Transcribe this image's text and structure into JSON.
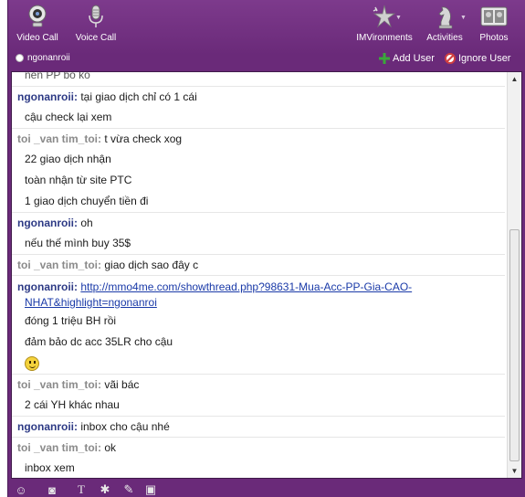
{
  "toolbar": {
    "video_call": "Video Call",
    "voice_call": "Voice Call",
    "imvironments": "IMVironments",
    "activities": "Activities",
    "photos": "Photos"
  },
  "status": {
    "contact": "ngonanroii",
    "add_user": "Add User",
    "ignore_user": "Ignore User"
  },
  "chat": {
    "partial_line": "nên PP bo ko",
    "messages": [
      {
        "sender": "ngonanroii",
        "text": "tại giao dịch chỉ có 1 cái"
      },
      {
        "continuation": "cậu check lại xem"
      },
      {
        "sender": "toi _van tim_toi",
        "text": "t vừa check xog"
      },
      {
        "continuation": "22 giao dịch nhận"
      },
      {
        "continuation": "toàn nhận từ site PTC"
      },
      {
        "continuation": "1 giao dịch chuyển tiền đi"
      },
      {
        "sender": "ngonanroii",
        "text": "oh"
      },
      {
        "continuation": "nếu thế mình buy 35$"
      },
      {
        "sender": "toi _van tim_toi",
        "text": "giao dịch sao đây c"
      }
    ],
    "link_message": {
      "sender": "ngonanroii",
      "link_part1": "http://mmo4me.com/showthread.php?98631-Mua-Acc-PP-Gia-CAO-",
      "link_part2": "NHAT&highlight=ngonanroi"
    },
    "messages2": [
      {
        "continuation": "đóng 1 triệu BH rồi"
      },
      {
        "continuation": "đảm bảo dc acc 35LR cho cậu"
      },
      {
        "emoji": "smiley-icon"
      },
      {
        "sender": "toi _van tim_toi",
        "text": "vãi bác"
      },
      {
        "continuation": "2 cái YH khác nhau"
      },
      {
        "sender": "ngonanroii",
        "text": "inbox cho cậu nhé"
      },
      {
        "sender": "toi _van tim_toi",
        "text": "ok"
      },
      {
        "continuation": "inbox xem"
      }
    ]
  },
  "colors": {
    "window": "#6a2a79",
    "self_name": "#2d3a85",
    "other_name": "#8a8a8a",
    "link": "#1a3aa8"
  }
}
